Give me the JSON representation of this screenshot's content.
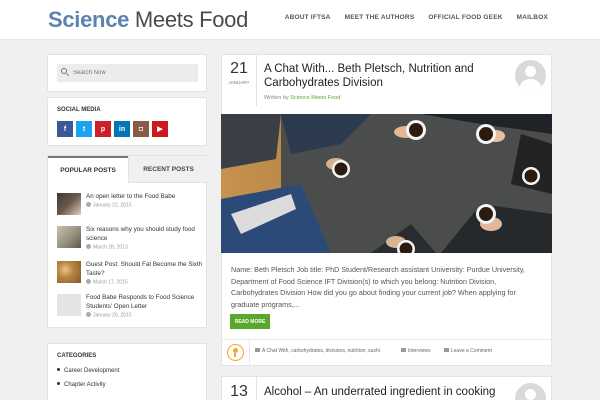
{
  "site": {
    "logo_part1": "Science",
    "logo_part2": "Meets Food"
  },
  "nav": [
    "ABOUT IFTSA",
    "MEET THE AUTHORS",
    "OFFICIAL FOOD GEEK",
    "MAILBOX"
  ],
  "search": {
    "placeholder": "Search Now"
  },
  "social": {
    "title": "SOCIAL MEDIA",
    "icons": [
      {
        "name": "facebook-icon",
        "glyph": "f",
        "color": "#3b5998"
      },
      {
        "name": "twitter-icon",
        "glyph": "t",
        "color": "#1da1f2"
      },
      {
        "name": "pinterest-icon",
        "glyph": "p",
        "color": "#cb2027"
      },
      {
        "name": "linkedin-icon",
        "glyph": "in",
        "color": "#0077b5"
      },
      {
        "name": "instagram-icon",
        "glyph": "◘",
        "color": "#8a5a44"
      },
      {
        "name": "youtube-icon",
        "glyph": "▶",
        "color": "#cc181e"
      }
    ]
  },
  "tabs": {
    "popular": "POPULAR POSTS",
    "recent": "RECENT POSTS"
  },
  "popular_posts": [
    {
      "title": "An open letter to the Food Babe",
      "date": "January 22, 2015"
    },
    {
      "title": "Six reasons why you should study food science",
      "date": "March 28, 2013"
    },
    {
      "title": "Guest Post: Should Fat Become the Sixth Taste?",
      "date": "March 17, 2015"
    },
    {
      "title": "Food Babe Responds to Food Science Students' Open Letter",
      "date": "January 26, 2015"
    }
  ],
  "categories": {
    "title": "CATEGORIES",
    "items": [
      "Career Development",
      "Chapter Activity"
    ]
  },
  "post": {
    "day": "21",
    "month": "JANUARY",
    "title": "A Chat With... Beth Pletsch, Nutrition and Carbohydrates Division",
    "byline_prefix": "Written by",
    "author": "Science Meets Food",
    "excerpt": " Name: Beth Pletsch Job title: PhD Student/Research assistant University: Purdue University, Department of Food Science IFT Division(s) to which you belong: Nutrition Division, Carbohydrates Division How did you go about finding your current job? When applying for graduate programs,...",
    "read_more": "READ MORE",
    "tags": "A Chat With, carbohydrates, divisions, nutrition, sushi",
    "category": "Interviews",
    "comments": "Leave a Comment"
  },
  "post2": {
    "day": "13",
    "title": "Alcohol – An underrated ingredient in cooking"
  }
}
